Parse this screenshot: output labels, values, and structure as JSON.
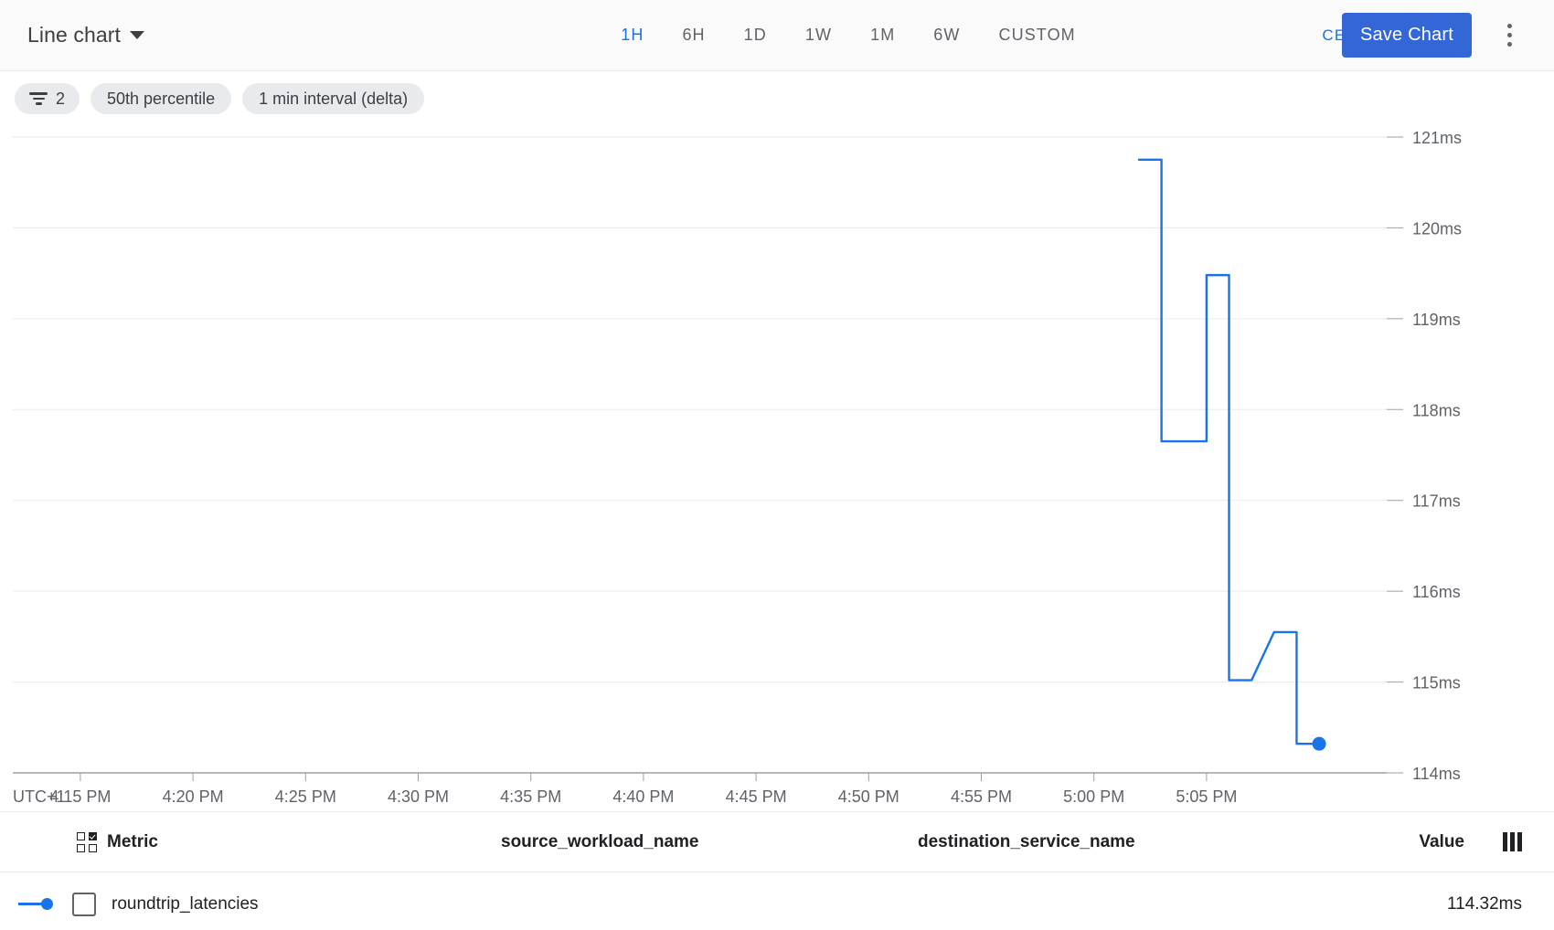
{
  "toolbar": {
    "chart_type": "Line chart",
    "chart_type_icon": "chevron-down-icon",
    "ranges": [
      {
        "label": "1H",
        "active": true
      },
      {
        "label": "6H",
        "active": false
      },
      {
        "label": "1D",
        "active": false
      },
      {
        "label": "1W",
        "active": false
      },
      {
        "label": "1M",
        "active": false
      },
      {
        "label": "6W",
        "active": false
      },
      {
        "label": "CUSTOM",
        "active": false
      }
    ],
    "timezone": "CET",
    "save_label": "Save Chart",
    "menu_icon": "kebab-menu-icon",
    "accent_color": "#1a73e8",
    "save_button_color": "#3367d6"
  },
  "chips": [
    {
      "label": "2",
      "icon": "filter-icon"
    },
    {
      "label": "50th percentile",
      "icon": null
    },
    {
      "label": "1 min interval (delta)",
      "icon": null
    }
  ],
  "chart_data": {
    "type": "line",
    "title": "",
    "xlabel": "",
    "ylabel": "",
    "timezone_label": "UTC+1",
    "grid": true,
    "legend_position": "bottom-table",
    "line_color": "#1a73e8",
    "ylim": [
      114,
      121
    ],
    "ytick_labels": [
      "121ms",
      "120ms",
      "119ms",
      "118ms",
      "117ms",
      "116ms",
      "115ms",
      "114ms"
    ],
    "ytick_values": [
      121,
      120,
      119,
      118,
      117,
      116,
      115,
      114
    ],
    "xtick_labels": [
      "4:15 PM",
      "4:20 PM",
      "4:25 PM",
      "4:30 PM",
      "4:35 PM",
      "4:40 PM",
      "4:45 PM",
      "4:50 PM",
      "4:55 PM",
      "5:00 PM",
      "5:05 PM"
    ],
    "xlim_minutes": [
      252,
      313
    ],
    "series": [
      {
        "name": "roundtrip_latencies",
        "unit": "ms",
        "points": [
          {
            "t": "5:02 PM",
            "x": 302,
            "y": 120.75
          },
          {
            "t": "5:03 PM",
            "x": 303,
            "y": 120.75
          },
          {
            "t": "5:03 PM",
            "x": 303,
            "y": 117.65
          },
          {
            "t": "5:05 PM",
            "x": 305,
            "y": 117.65
          },
          {
            "t": "5:05 PM",
            "x": 305,
            "y": 119.48
          },
          {
            "t": "5:06 PM",
            "x": 306,
            "y": 119.48
          },
          {
            "t": "5:06 PM",
            "x": 306,
            "y": 115.02
          },
          {
            "t": "5:07 PM",
            "x": 307,
            "y": 115.02
          },
          {
            "t": "5:08 PM",
            "x": 308,
            "y": 115.55
          },
          {
            "t": "5:09 PM",
            "x": 309,
            "y": 115.55
          },
          {
            "t": "5:09 PM",
            "x": 309,
            "y": 114.32
          },
          {
            "t": "5:10 PM",
            "x": 310,
            "y": 114.32
          }
        ],
        "last_value": 114.32
      }
    ]
  },
  "legend_table": {
    "columns": [
      {
        "key": "metric",
        "label": "Metric",
        "icon": "grid-checkbox-icon"
      },
      {
        "key": "source_workload_name",
        "label": "source_workload_name"
      },
      {
        "key": "destination_service_name",
        "label": "destination_service_name"
      },
      {
        "key": "value",
        "label": "Value",
        "icon": "column-resize-icon"
      }
    ],
    "rows": [
      {
        "metric": "roundtrip_latencies",
        "source_workload_name": "",
        "destination_service_name": "",
        "value": "114.32ms",
        "checked": false,
        "color": "#1a73e8"
      }
    ]
  }
}
